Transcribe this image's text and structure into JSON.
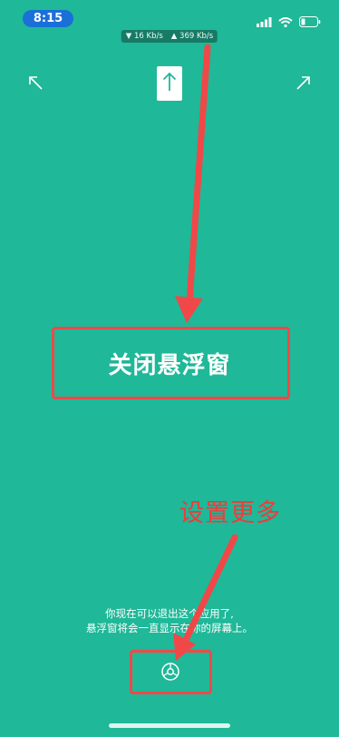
{
  "status_bar": {
    "time": "8:15",
    "download_speed": "▼ 16 Kb/s",
    "upload_speed": "▲ 369 Kb/s",
    "icons": [
      "signal-icon",
      "wifi-icon",
      "battery-icon"
    ]
  },
  "main": {
    "close_floating_window_label": "关闭悬浮窗",
    "hint_line1": "你现在可以退出这个应用了,",
    "hint_line2": "悬浮窗将会一直显示在你的屏幕上。",
    "icons": [
      "shrink-arrow-icon",
      "up-arrow-icon",
      "expand-arrow-icon",
      "settings-gear-icon"
    ]
  },
  "annotations": {
    "more_settings_label": "设置更多",
    "color": "#f04848"
  },
  "colors": {
    "background": "#1fb898",
    "time_pill": "#1a6fd9",
    "annotation": "#f04848"
  }
}
